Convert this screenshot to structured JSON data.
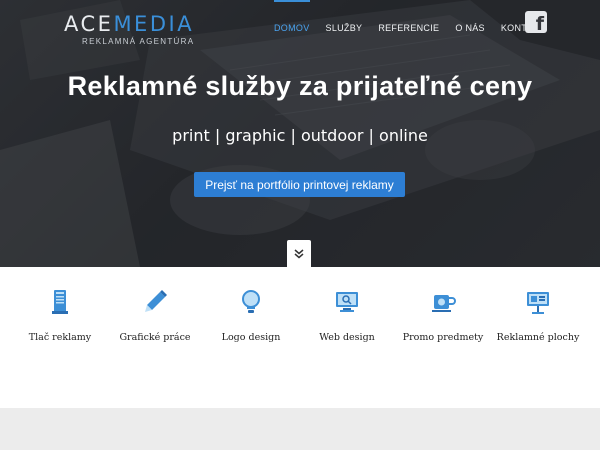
{
  "brand": {
    "logo_part1": "ACE",
    "logo_part2": "MEDIA",
    "tagline": "REKLAMNÁ AGENTÚRA",
    "accent_color": "#2d7ed4"
  },
  "nav": {
    "items": [
      {
        "label": "DOMOV",
        "active": true
      },
      {
        "label": "SLUŽBY",
        "active": false
      },
      {
        "label": "REFERENCIE",
        "active": false
      },
      {
        "label": "O NÁS",
        "active": false
      },
      {
        "label": "KONTAKT",
        "active": false
      }
    ],
    "social_icon": "facebook-icon"
  },
  "hero": {
    "title": "Reklamné služby za prijateľné ceny",
    "subtitle": "print | graphic | outdoor | online",
    "cta_label": "Prejsť na portfólio printovej reklamy",
    "scroll_icon": "double-chevron-down-icon"
  },
  "services": [
    {
      "label": "Tlač reklamy",
      "icon": "print-icon"
    },
    {
      "label": "Grafické práce",
      "icon": "pencil-icon"
    },
    {
      "label": "Logo design",
      "icon": "lightbulb-icon"
    },
    {
      "label": "Web design",
      "icon": "monitor-icon"
    },
    {
      "label": "Promo predmety",
      "icon": "mug-icon"
    },
    {
      "label": "Reklamné plochy",
      "icon": "billboard-icon"
    }
  ]
}
